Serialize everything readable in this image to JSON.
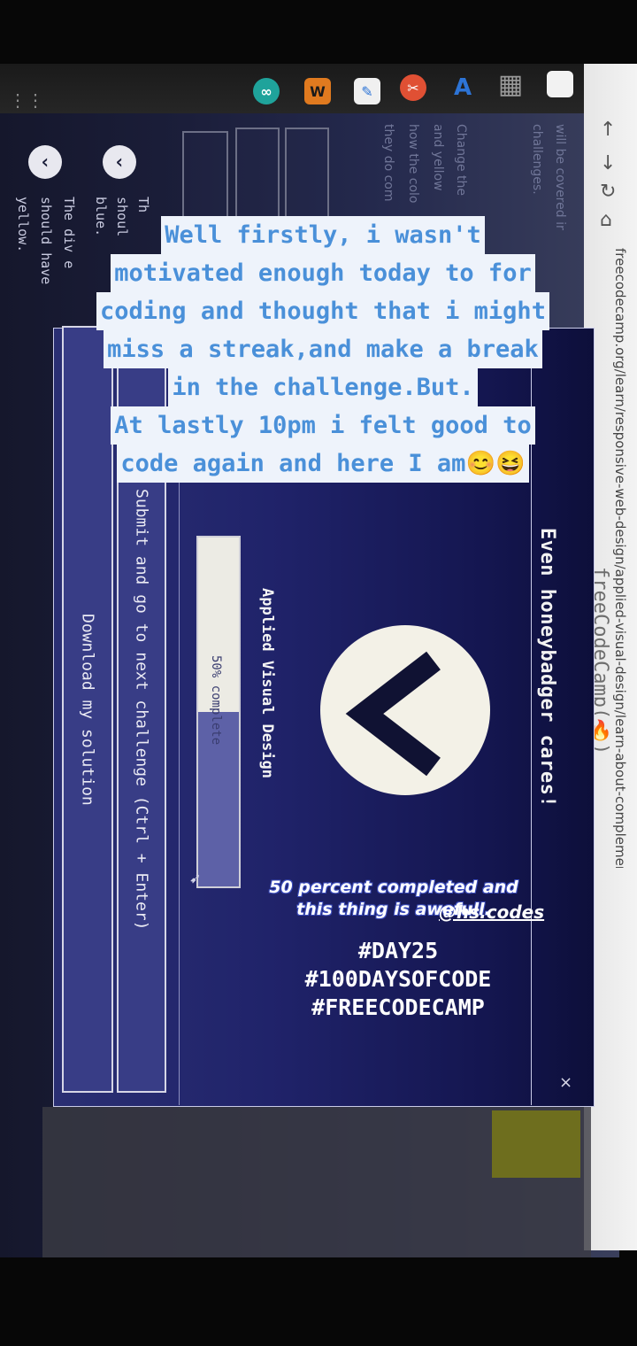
{
  "browser": {
    "url": "freecodecamp.org/learn/responsive-web-design/applied-visual-design/learn-about-complementary-colors",
    "logo_text": "freeCodeCamp(🔥)",
    "extensions": [
      {
        "name": "extension-infinity",
        "glyph": "∞",
        "color": "#1fa39b"
      },
      {
        "name": "extension-w",
        "glyph": "W",
        "color": "#e07a1f"
      },
      {
        "name": "extension-pen",
        "glyph": "✎",
        "color": "#f0f0f0"
      },
      {
        "name": "extension-red",
        "glyph": "✂",
        "color": "#e05034"
      },
      {
        "name": "extension-azure",
        "glyph": "A",
        "color": "#2d74d6"
      },
      {
        "name": "extension-doc",
        "glyph": "▦",
        "color": "#9a9a9a"
      },
      {
        "name": "extension-blank",
        "glyph": "",
        "color": "#f2f2f2"
      },
      {
        "name": "chrome",
        "glyph": "●",
        "color": "#2f7ad8"
      }
    ]
  },
  "page": {
    "desc_lines": [
      "will be covered in",
      "challenges.",
      "Change the",
      "and yellow",
      "how the colo",
      "they do com"
    ],
    "instructions": [
      "Th",
      "shoul",
      "blue.",
      "The div e",
      "should have",
      "yellow."
    ]
  },
  "modal": {
    "title": "Even honeybadger cares!",
    "close_glyph": "×",
    "course": "Applied Visual Design",
    "progress": {
      "percent": 50,
      "label": "50% complete"
    },
    "submit_label": "Submit and go to next challenge (Ctrl + Enter)",
    "download_label": "Download my solution"
  },
  "overlay": {
    "caption_lines": [
      "Well firstly, i wasn't",
      "motivated enough today to for",
      "coding and thought that i might",
      "miss a streak,and make a break",
      "in the challenge.But.",
      "At lastly 10pm i felt good to",
      "code again and here I am😊😆"
    ],
    "note": "50 percent completed and this thing is awefull.",
    "handle": "@hs.codes",
    "tags": [
      "#DAY25",
      "#100DAYSOFCODE",
      "#FREECODECAMP"
    ]
  }
}
